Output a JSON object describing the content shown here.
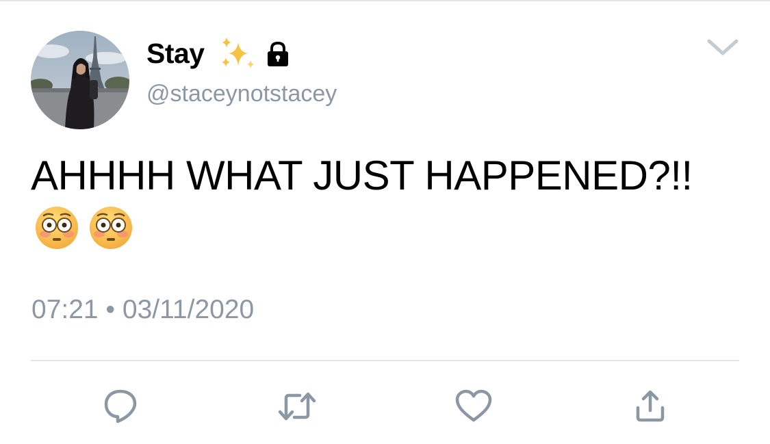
{
  "tweet": {
    "display_name": "Stay",
    "name_badges": [
      "sparkles-icon",
      "lock-icon"
    ],
    "handle": "@staceynotstacey",
    "text": "AHHHH WHAT JUST HAPPENED?!!",
    "emojis": [
      "flushed-face",
      "flushed-face"
    ],
    "timestamp": "07:21 • 03/11/2020"
  },
  "actions": [
    {
      "name": "reply",
      "icon": "reply-icon"
    },
    {
      "name": "retweet",
      "icon": "retweet-icon"
    },
    {
      "name": "like",
      "icon": "heart-icon"
    },
    {
      "name": "share",
      "icon": "share-icon"
    }
  ],
  "colors": {
    "secondary_text": "#8b98a4",
    "icon_gray": "#8b98a4",
    "divider": "#e1e5e8",
    "sparkle": "#f5c242"
  }
}
